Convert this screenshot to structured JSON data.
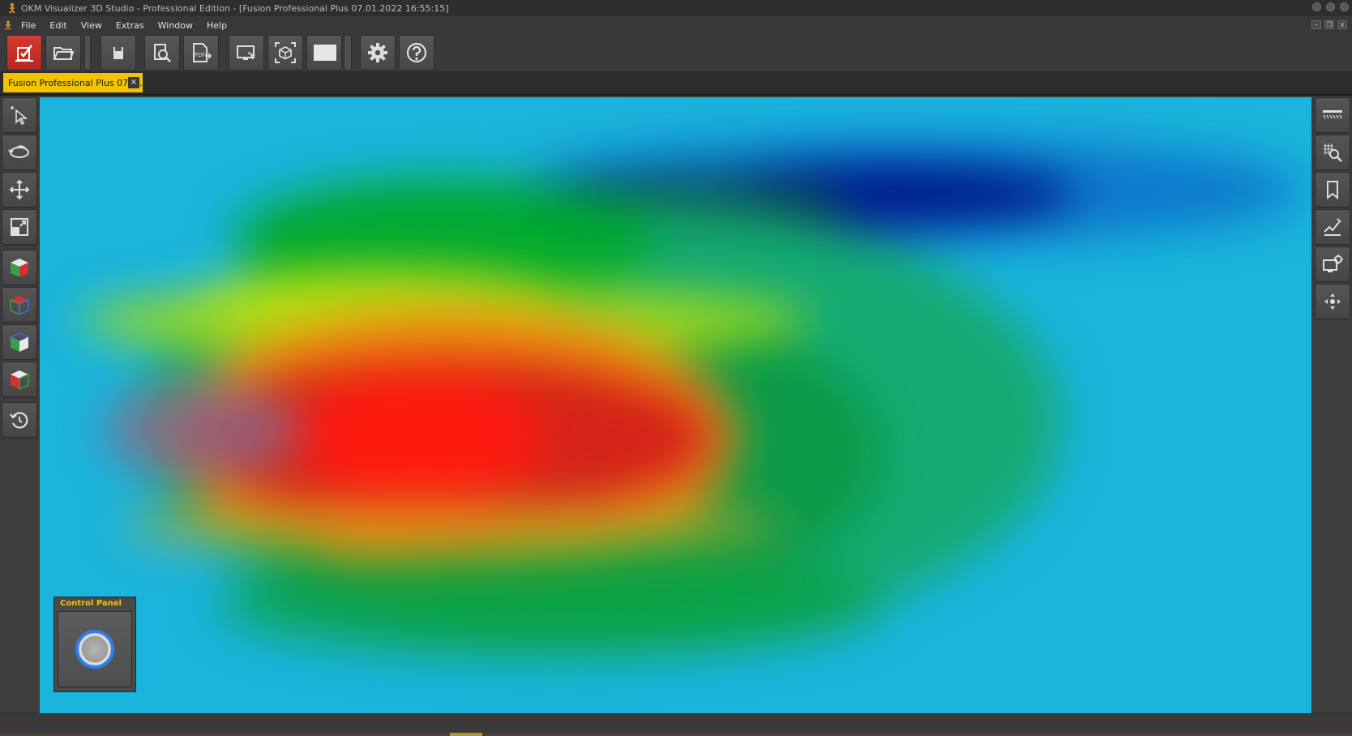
{
  "window": {
    "title": "OKM Visualizer 3D Studio - Professional Edition - [Fusion Professional Plus 07.01.2022 16:55:15]",
    "app_icon": "okm-figure-icon"
  },
  "menu": {
    "items": [
      "File",
      "Edit",
      "View",
      "Extras",
      "Window",
      "Help"
    ]
  },
  "toolbar": {
    "buttons": [
      {
        "name": "new-scan-icon",
        "accent": "#c8302a"
      },
      {
        "name": "open-folder-icon"
      },
      {
        "name": "save-disk-icon"
      },
      {
        "name": "search-document-icon"
      },
      {
        "name": "export-pdf-icon"
      },
      {
        "name": "screenshot-icon"
      },
      {
        "name": "3d-cube-view-icon"
      },
      {
        "name": "background-color-icon"
      },
      {
        "name": "settings-gear-icon"
      },
      {
        "name": "help-icon"
      }
    ]
  },
  "tabs": {
    "active_label": "Fusion Professional Plus 07.0...",
    "close": "×",
    "accent": "#f2c300"
  },
  "left_tools": [
    "select-pointer-icon",
    "rotate-icon",
    "move-icon",
    "zoom-scale-icon",
    "cube-view-icon",
    "top-view-icon",
    "side-view-icon",
    "front-view-icon",
    "reset-view-icon"
  ],
  "right_tools": [
    "surface-grid-icon",
    "zoom-grid-icon",
    "bookmark-icon",
    "measure-icon",
    "view-settings-icon",
    "navigation-cross-icon"
  ],
  "control_panel": {
    "title": "Control Panel",
    "joystick_accent": "#2f7fe8"
  },
  "viewport": {
    "colors": {
      "background": "#1ab4dc",
      "deep_blue": "#001a8c",
      "green": "#00a830",
      "yellow": "#b8e010",
      "orange": "#f08c10",
      "red": "#ff1a10"
    }
  }
}
